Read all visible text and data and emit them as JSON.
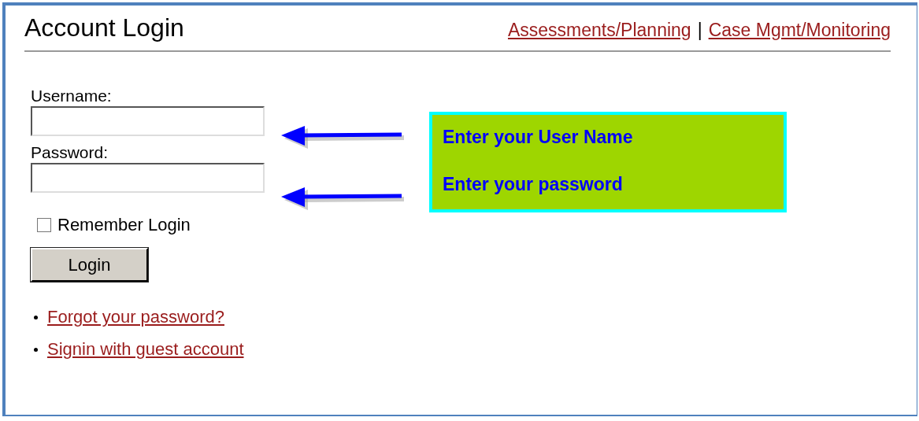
{
  "header": {
    "title": "Account Login",
    "links": [
      "Assessments/Planning",
      "Case Mgmt/Monitoring"
    ],
    "separator": "|"
  },
  "form": {
    "fields": [
      {
        "label": "Username:"
      },
      {
        "label": "Password:"
      }
    ],
    "remember": {
      "label": "Remember Login",
      "checked": false
    },
    "button": "Login"
  },
  "links": [
    "Forgot your password?",
    "Signin with guest account"
  ],
  "callout": {
    "lines": [
      "Enter your User Name",
      "Enter your password"
    ]
  }
}
